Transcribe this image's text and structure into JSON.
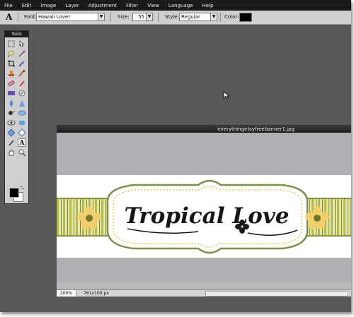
{
  "menu": [
    "File",
    "Edit",
    "Image",
    "Layer",
    "Adjustment",
    "Filter",
    "View",
    "Language",
    "Help"
  ],
  "options": {
    "tool_icon": "type-tool-icon",
    "font_label": "Font:",
    "font_value": "Hawaii Lover",
    "size_label": "Size:",
    "size_value": "55",
    "style_label": "Style:",
    "style_value": "Regular",
    "color_label": "Color:",
    "color_value": "#000000"
  },
  "tools": {
    "title": "Tools",
    "items": [
      "marquee",
      "move",
      "lasso",
      "magic-wand",
      "crop",
      "pencil",
      "stamp",
      "brush",
      "eraser",
      "color-replace",
      "gradient",
      "sharpen",
      "blur",
      "drop",
      "smudge",
      "bloat",
      "dodge",
      "eye",
      "sponge",
      "red-eye",
      "pinch",
      "shapes",
      "eyedropper",
      "type",
      "hand",
      "zoom"
    ],
    "type_glyph": "A",
    "foreground": "#000000",
    "background": "#ffffff"
  },
  "document": {
    "title": "everythingetsyfreebanner1.jpg",
    "zoom": "200%",
    "dimensions": "761x100 px",
    "banner_text": "Tropical Love",
    "colors": {
      "stripe": "#b5bb4c",
      "frame_green": "#7b8f45",
      "flower": "#f2cf6a",
      "canvas": "#afb0b3"
    }
  }
}
